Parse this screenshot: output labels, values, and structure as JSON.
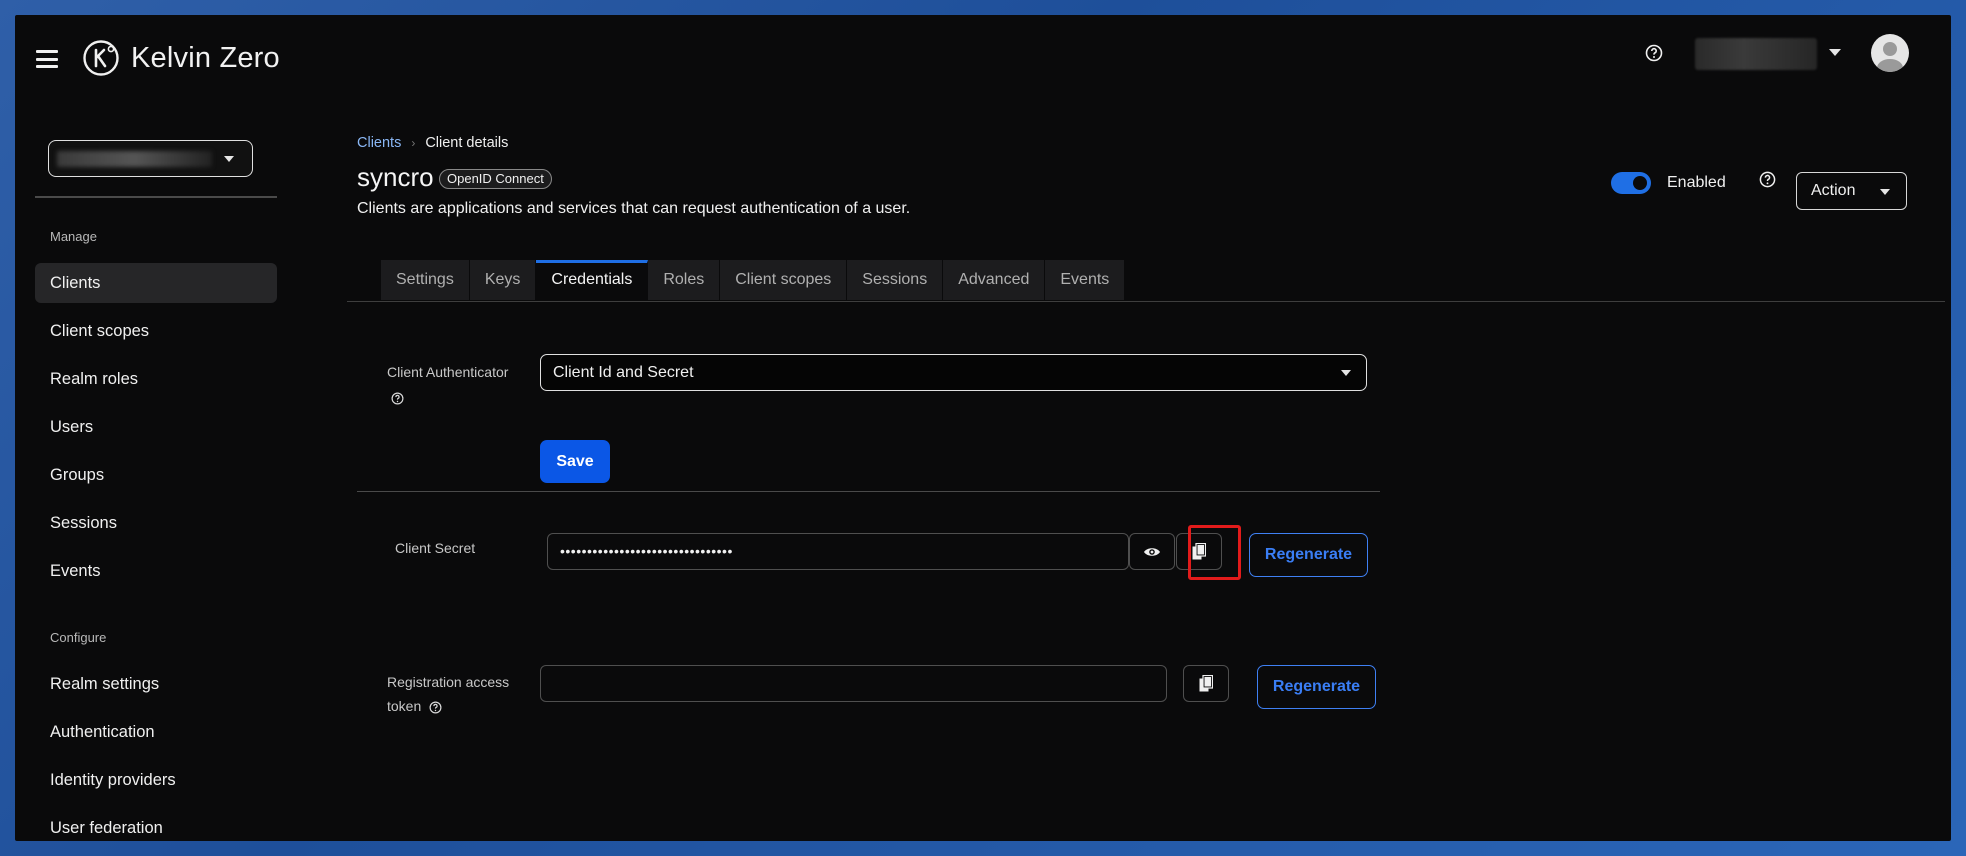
{
  "brand": {
    "name": "Kelvin Zero"
  },
  "colors": {
    "accent": "#1f6fe5",
    "primary_button": "#0b57e6",
    "highlight": "#e21b1b",
    "link": "#8ab7f5"
  },
  "sidebar": {
    "groups": [
      {
        "title": "Manage",
        "items": [
          "Clients",
          "Client scopes",
          "Realm roles",
          "Users",
          "Groups",
          "Sessions",
          "Events"
        ]
      },
      {
        "title": "Configure",
        "items": [
          "Realm settings",
          "Authentication",
          "Identity providers",
          "User federation"
        ]
      }
    ],
    "active_item": "Clients"
  },
  "breadcrumb": {
    "parent": "Clients",
    "current": "Client details"
  },
  "page": {
    "title": "syncro",
    "protocol_badge": "OpenID Connect",
    "description": "Clients are applications and services that can request authentication of a user."
  },
  "header_controls": {
    "enabled_label": "Enabled",
    "enabled": true,
    "action_label": "Action"
  },
  "tabs": [
    "Settings",
    "Keys",
    "Credentials",
    "Roles",
    "Client scopes",
    "Sessions",
    "Advanced",
    "Events"
  ],
  "active_tab": "Credentials",
  "form": {
    "authenticator_label": "Client Authenticator",
    "authenticator_value": "Client Id and Secret",
    "save_label": "Save",
    "secret_label": "Client Secret",
    "secret_value": "••••••••••••••••••••••••••••••••",
    "regenerate_label": "Regenerate",
    "reg_token_label_line1": "Registration access",
    "reg_token_label_line2": "token",
    "reg_token_value": ""
  },
  "icons": {
    "menu": "hamburger-icon",
    "help": "help-icon",
    "avatar": "user-avatar-icon",
    "show": "eye-icon",
    "copy": "copy-icon",
    "caret": "caret-down-icon"
  }
}
